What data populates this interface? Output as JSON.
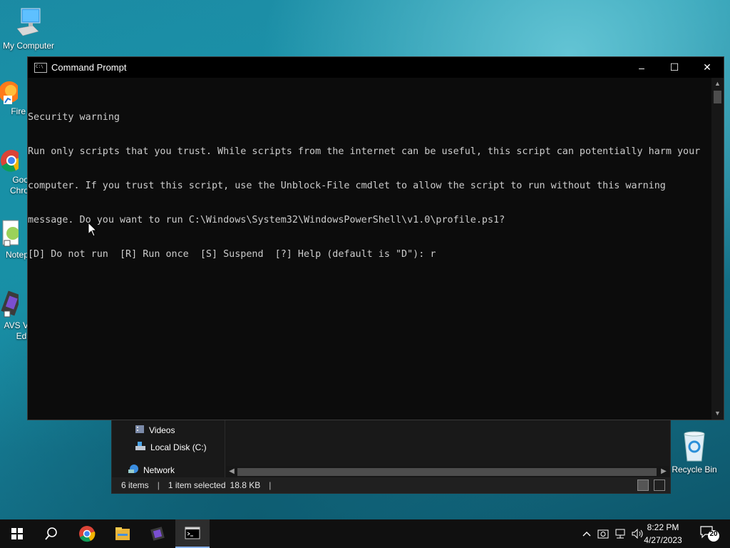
{
  "desktop": {
    "icons": [
      {
        "label": "My Computer"
      },
      {
        "label": "Fire"
      },
      {
        "label": "Goo"
      },
      {
        "label": "Chro"
      },
      {
        "label": "Notep"
      },
      {
        "label": "AVS V"
      },
      {
        "label": "Edi"
      },
      {
        "label": "Recycle Bin"
      }
    ]
  },
  "cmd": {
    "title": "Command Prompt",
    "controls": {
      "minimize": "–",
      "maximize": "☐",
      "close": "✕"
    },
    "lines": [
      "Security warning",
      "Run only scripts that you trust. While scripts from the internet can be useful, this script can potentially harm your",
      "computer. If you trust this script, use the Unblock-File cmdlet to allow the script to run without this warning",
      "message. Do you want to run C:\\Windows\\System32\\WindowsPowerShell\\v1.0\\profile.ps1?",
      "[D] Do not run  [R] Run once  [S] Suspend  [?] Help (default is \"D\"): r"
    ]
  },
  "explorer": {
    "nav": [
      {
        "label": "Videos",
        "icon": "videos-folder-icon"
      },
      {
        "label": "Local Disk (C:)",
        "icon": "local-disk-icon"
      },
      {
        "label": "Network",
        "icon": "network-icon"
      }
    ],
    "status": {
      "items": "6 items",
      "selected": "1 item selected",
      "size": "18.8 KB"
    }
  },
  "taskbar": {
    "apps": [
      "start",
      "search",
      "chrome",
      "file-explorer",
      "avs-video-editor",
      "command-prompt"
    ],
    "clock": {
      "time": "8:22 PM",
      "date": "4/27/2023"
    },
    "notifications": "20"
  },
  "colors": {
    "console_bg": "#0c0c0c",
    "console_text": "#cccccc",
    "taskbar": "#101010",
    "accent": "#8ab4f8"
  }
}
